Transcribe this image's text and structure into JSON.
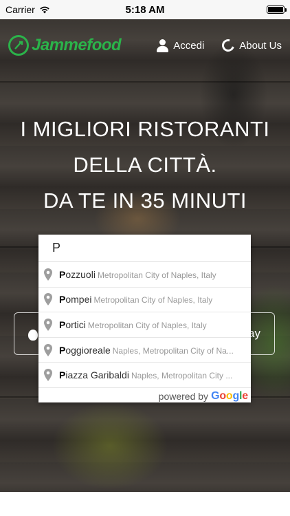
{
  "status_bar": {
    "carrier": "Carrier",
    "time": "5:18 AM",
    "wifi_icon": "wifi-icon",
    "battery_icon": "battery-icon"
  },
  "header": {
    "logo_text": "Jammefood",
    "login_label": "Accedi",
    "about_label": "About Us"
  },
  "hero": {
    "line1": "I MIGLIORI RISTORANTI",
    "line2": "DELLA CITTÀ.",
    "line3": "DA TE IN 35 MINUTI"
  },
  "cta": {
    "text": "ay"
  },
  "search": {
    "value": "P",
    "suggestions": [
      {
        "match": "P",
        "rest": "ozzuoli",
        "secondary": "Metropolitan City of Naples, Italy"
      },
      {
        "match": "P",
        "rest": "ompei",
        "secondary": "Metropolitan City of Naples, Italy"
      },
      {
        "match": "P",
        "rest": "ortici",
        "secondary": "Metropolitan City of Naples, Italy"
      },
      {
        "match": "P",
        "rest": "oggioreale",
        "secondary": "Naples, Metropolitan City of Na..."
      },
      {
        "match": "P",
        "rest": "iazza Garibaldi",
        "secondary": "Naples, Metropolitan City ..."
      }
    ],
    "powered_by": "powered by",
    "google": "Google"
  },
  "colors": {
    "brand_green": "#2bb34a"
  }
}
